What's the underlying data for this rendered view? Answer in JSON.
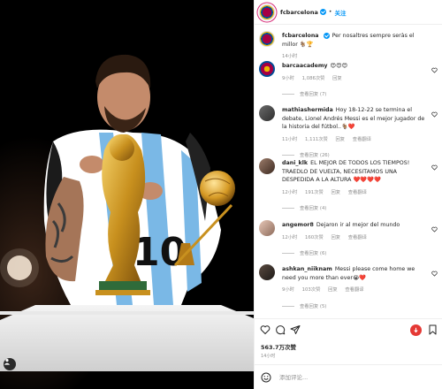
{
  "header": {
    "username": "fcbarcelona",
    "separator": "•",
    "follow_label": "关注"
  },
  "caption": {
    "username": "fcbarcelona",
    "text": "Per nosaltres sempre seràs el millor 🐐🏆",
    "time": "14小时"
  },
  "comments": [
    {
      "username": "barcaacademy",
      "text": "😍😍😍",
      "time": "9小时",
      "likes": "1,086次赞",
      "reply": "回复",
      "view_replies": "查看回复 (7)"
    },
    {
      "username": "mathiashermida",
      "text": "Hoy 18-12-22 se termina el debate, Lionel Andrés Messi es el mejor jugador de la historia del fútbol..🐐❤️",
      "time": "11小时",
      "likes": "1,111次赞",
      "reply": "回复",
      "translate": "查看翻译",
      "view_replies": "查看回复 (26)"
    },
    {
      "username": "dani_klk",
      "text": "EL MEJOR DE TODOS LOS TIEMPOS! TRAEDLO DE VUELTA, NECESITAMOS UNA DESPEDIDA A LA ALTURA ❤️❤️❤️❤️",
      "time": "12小时",
      "likes": "191次赞",
      "reply": "回复",
      "translate": "查看翻译",
      "view_replies": "查看回复 (4)"
    },
    {
      "username": "angemor8",
      "text": "Dejaron ir al mejor del mundo",
      "time": "12小时",
      "likes": "160次赞",
      "reply": "回复",
      "translate": "查看翻译",
      "view_replies": "查看回复 (6)"
    },
    {
      "username": "ashkan_niiknam",
      "text": "Messi please come home we need you more than ever😭❤️",
      "time": "9小时",
      "likes": "103次赞",
      "reply": "回复",
      "translate": "查看翻译",
      "view_replies": "查看回复 (5)"
    }
  ],
  "actions": {
    "likes": "563.7万次赞",
    "time": "14小时"
  },
  "comment_box": {
    "placeholder": "添加评论..."
  },
  "icons": [
    "heart-icon",
    "comment-icon",
    "share-icon",
    "bookmark-icon",
    "emoji-icon",
    "user-tag-icon"
  ],
  "colors": {
    "accent": "#0095f6",
    "red": "#e53935",
    "barca_blue": "#004d98",
    "barca_red": "#a50044"
  }
}
